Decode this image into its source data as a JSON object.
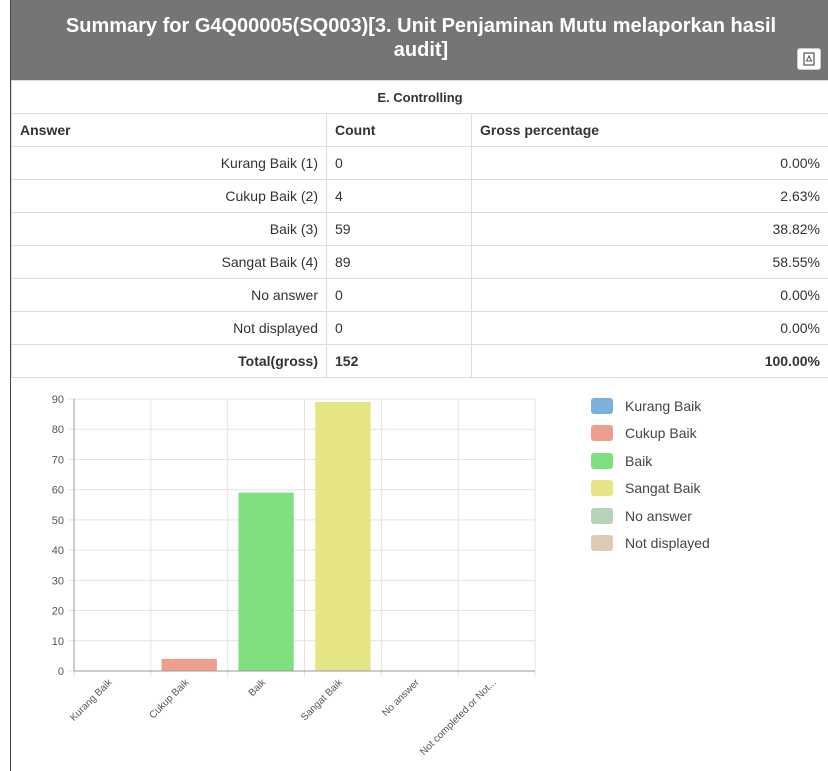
{
  "header": {
    "title": "Summary for G4Q00005(SQ003)[3. Unit Penjaminan Mutu melaporkan hasil audit]",
    "export_icon": "pdf-export-icon"
  },
  "table": {
    "section": "E. Controlling",
    "columns": [
      "Answer",
      "Count",
      "Gross percentage"
    ],
    "rows": [
      {
        "answer": "Kurang Baik (1)",
        "count": "0",
        "pct": "0.00%"
      },
      {
        "answer": "Cukup Baik (2)",
        "count": "4",
        "pct": "2.63%"
      },
      {
        "answer": "Baik (3)",
        "count": "59",
        "pct": "38.82%"
      },
      {
        "answer": "Sangat Baik (4)",
        "count": "89",
        "pct": "58.55%"
      },
      {
        "answer": "No answer",
        "count": "0",
        "pct": "0.00%"
      },
      {
        "answer": "Not displayed",
        "count": "0",
        "pct": "0.00%"
      }
    ],
    "total": {
      "answer": "Total(gross)",
      "count": "152",
      "pct": "100.00%"
    }
  },
  "chart_data": {
    "type": "bar",
    "categories": [
      "Kurang Baik",
      "Cukup Baik",
      "Baik",
      "Sangat Baik",
      "No answer",
      "Not completed or Not..."
    ],
    "values": [
      0,
      4,
      59,
      89,
      0,
      0
    ],
    "ylim": [
      0,
      90
    ],
    "yticks": [
      0,
      10,
      20,
      30,
      40,
      50,
      60,
      70,
      80,
      90
    ],
    "colors": [
      "#7eb0de",
      "#ee9f8c",
      "#7fe080",
      "#e5e585",
      "#b8d4b8",
      "#decbb5"
    ],
    "legend": [
      "Kurang Baik",
      "Cukup Baik",
      "Baik",
      "Sangat Baik",
      "No answer",
      "Not displayed"
    ],
    "legend_position": "right",
    "grid": true
  }
}
